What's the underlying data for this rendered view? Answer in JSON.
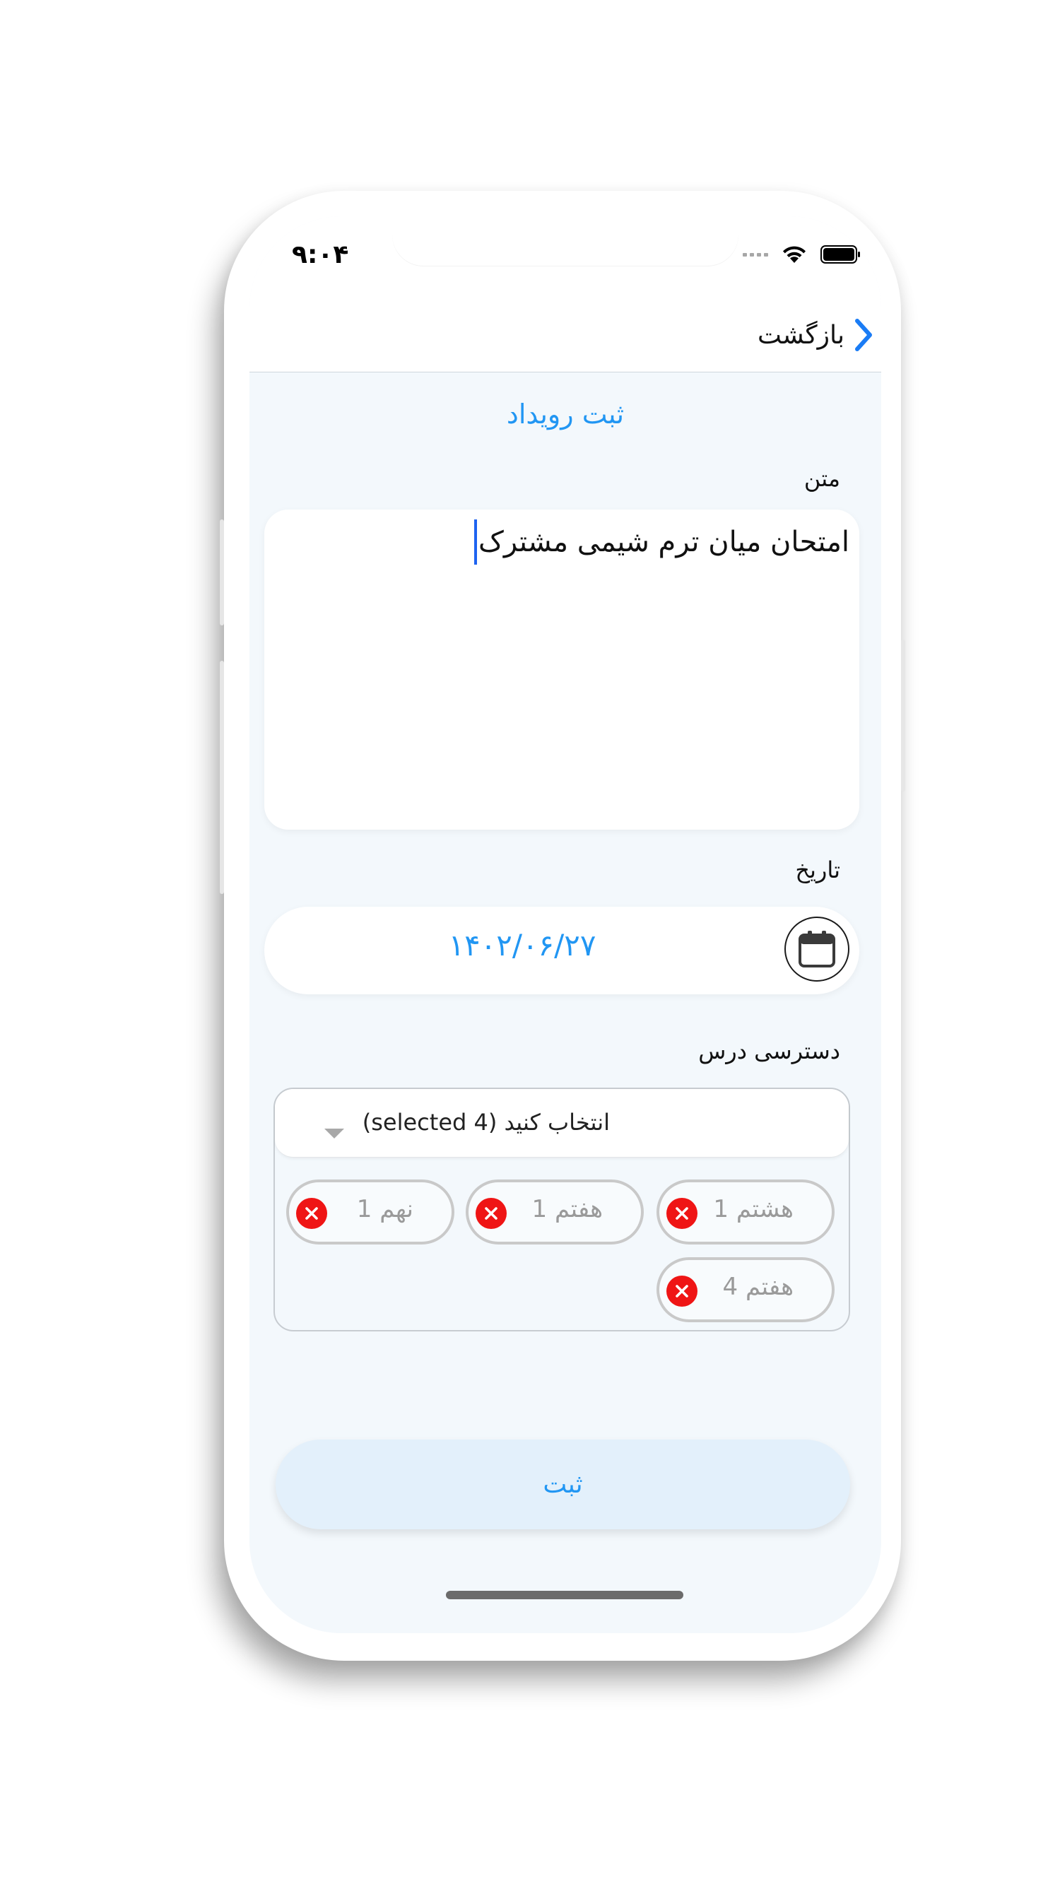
{
  "status_bar": {
    "time": "۹:۰۴",
    "wifi_icon": "wifi-icon",
    "battery_icon": "battery-icon"
  },
  "nav": {
    "back_label": "بازگشت",
    "back_icon": "chevron-right-icon"
  },
  "page": {
    "title": "ثبت رویداد"
  },
  "form": {
    "text_label": "متن",
    "text_value": "امتحان میان ترم شیمی مشترک",
    "date_label": "تاریخ",
    "date_value": "۱۴۰۲/۰۶/۲۷",
    "calendar_icon": "calendar-icon",
    "access_label": "دسترسی درس",
    "access_select_text": "انتخاب کنید (4 selected)",
    "access_selected": [
      {
        "label": "هشتم 1"
      },
      {
        "label": "هفتم 1"
      },
      {
        "label": "نهم 1"
      },
      {
        "label": "هفتم 4"
      }
    ],
    "submit_label": "ثبت"
  },
  "colors": {
    "accent": "#2196f3",
    "screen_bg": "#f3f8fc",
    "remove_red": "#ef1515",
    "chip_border": "#c9c9c9"
  }
}
